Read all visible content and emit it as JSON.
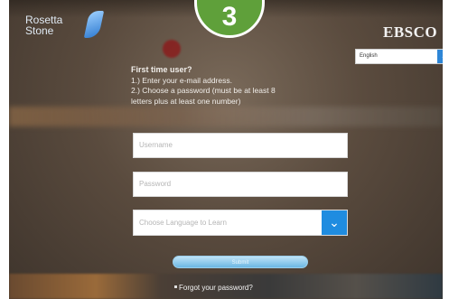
{
  "header": {
    "logo_line1": "Rosetta",
    "logo_line2": "Stone",
    "step_number": "3",
    "publisher": "EBSCO"
  },
  "language_select": {
    "selected": "English"
  },
  "intro": {
    "heading": "First time user?",
    "step1": "1.) Enter your e-mail address.",
    "step2_line1": "2.) Choose a password (must be at least 8",
    "step2_line2": "letters plus at least one number)"
  },
  "form": {
    "username_placeholder": "Username",
    "password_placeholder": "Password",
    "language_placeholder": "Choose Language to Learn",
    "submit_label": "Submit",
    "forgot_label": "Forgot your password?"
  }
}
